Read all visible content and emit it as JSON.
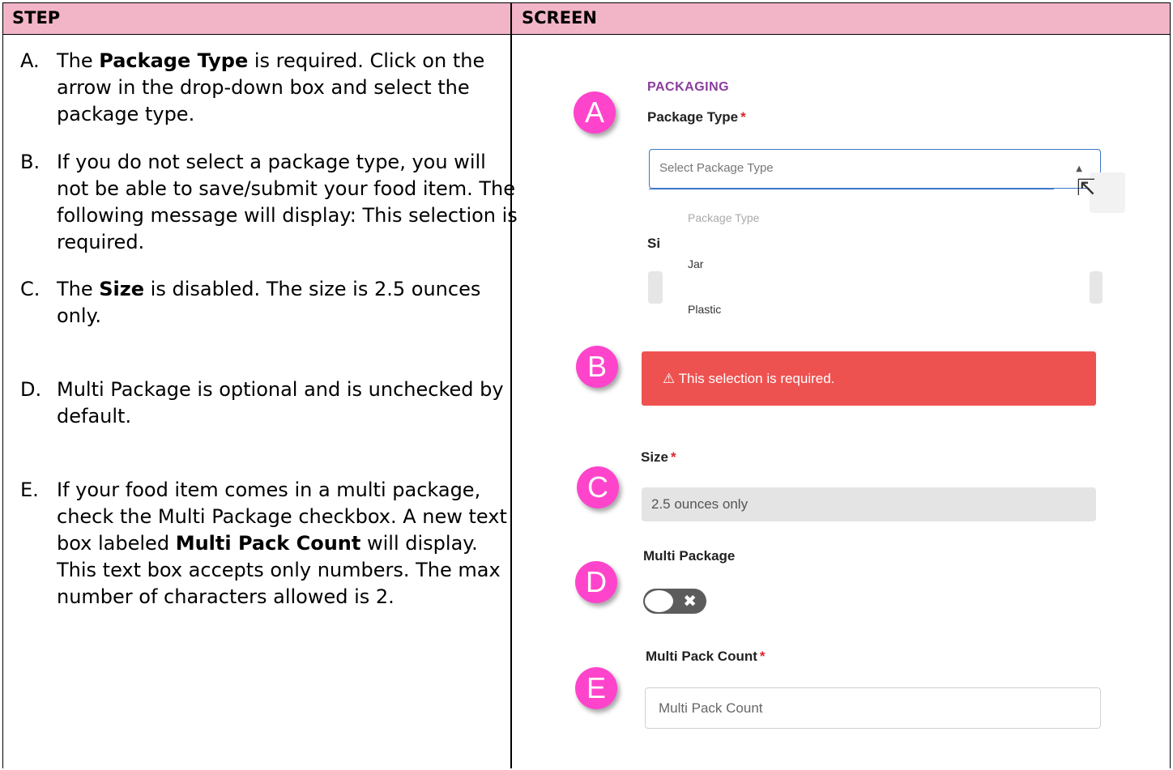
{
  "table": {
    "col_step": "STEP",
    "col_screen": "SCREEN"
  },
  "steps": [
    {
      "letter": "A.",
      "parts": [
        [
          "The ",
          false
        ],
        [
          "Package Type",
          true
        ],
        [
          " is required. Click on the arrow in the drop-down box and select the package type.",
          false
        ]
      ]
    },
    {
      "letter": "B.",
      "parts": [
        [
          "If you do not select a package type, you will not be able to save/submit your food item.  The following message will display: This selection is required.",
          false
        ]
      ]
    },
    {
      "letter": "C.",
      "parts": [
        [
          "The ",
          false
        ],
        [
          "Size",
          true
        ],
        [
          " is disabled.  The size is 2.5 ounces only.",
          false
        ]
      ]
    },
    {
      "letter": "D.",
      "parts": [
        [
          "Multi Package is optional and is unchecked by default.",
          false
        ]
      ]
    },
    {
      "letter": "E.",
      "parts": [
        [
          "If your food item comes in a multi package, check the Multi Package checkbox.  A new text box labeled ",
          false
        ],
        [
          "Multi Pack Count",
          true
        ],
        [
          " will display.  This text box accepts only numbers.  The max number of characters allowed is 2.",
          false
        ]
      ]
    }
  ],
  "screen": {
    "badges": {
      "a": "A",
      "b": "B",
      "c": "C",
      "d": "D",
      "e": "E"
    },
    "section_title": "PACKAGING",
    "package_type_label": "Package Type",
    "required_mark": "*",
    "package_type_placeholder": "Select Package Type",
    "dropdown": {
      "header": "Package Type",
      "options": [
        "Jar",
        "Plastic"
      ]
    },
    "obscured_label": "Si",
    "error_message": "⚠ This selection is required.",
    "error_color": "#ee5250",
    "size_label": "Size",
    "size_value": "2.5 ounces only",
    "multi_package_label": "Multi Package",
    "multi_package_toggle": {
      "checked": false,
      "off_glyph": "✖"
    },
    "multi_pack_count_label": "Multi Pack Count",
    "multi_pack_count_placeholder": "Multi Pack Count",
    "badge_color": "#ff44cc",
    "header_color": "#f2b5c8"
  }
}
